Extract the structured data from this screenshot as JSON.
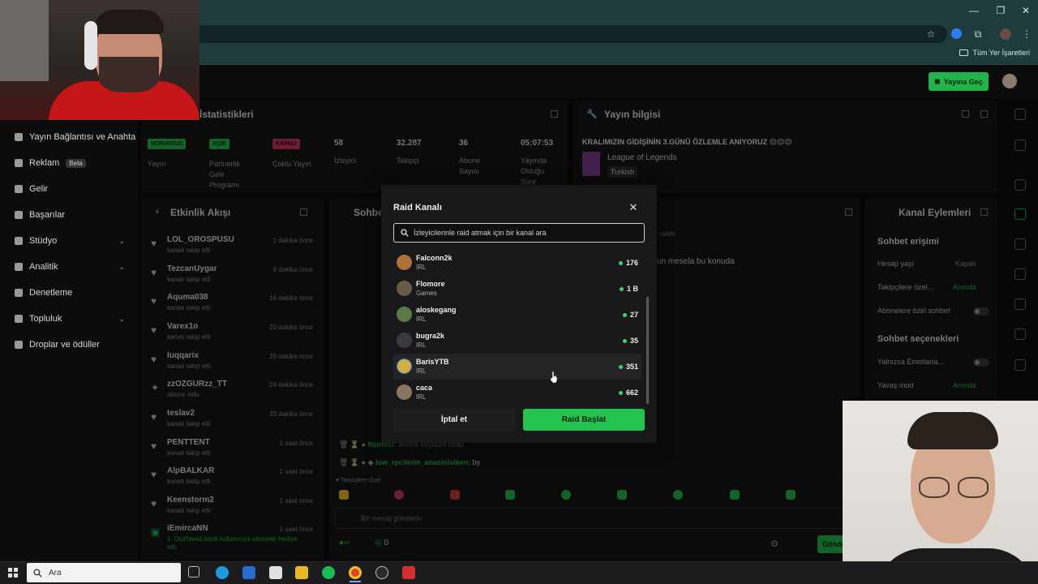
{
  "browser": {
    "bookmark_folder": "Tüm Yer İşaretleri"
  },
  "header": {
    "go_live_label": "Yayına Geç"
  },
  "sidebar": {
    "items": [
      {
        "label": "Yayın Bağlantısı ve Anahtarı"
      },
      {
        "label": "Reklam",
        "badge": "Beta"
      },
      {
        "label": "Gelir"
      },
      {
        "label": "Başarılar"
      },
      {
        "label": "Stüdyo"
      },
      {
        "label": "Analitik"
      },
      {
        "label": "Denetleme"
      },
      {
        "label": "Topluluk"
      },
      {
        "label": "Droplar ve ödüller"
      }
    ]
  },
  "stats": {
    "title": "İstatistikleri",
    "badges": [
      {
        "text": "SORUNSUZ",
        "label": "Yayın",
        "color": "#23b24a"
      },
      {
        "text": "AÇIK",
        "label": "Partnerlik Gelir Programı",
        "color": "#23b24a"
      },
      {
        "text": "KAPALI",
        "label": "Çoklu Yayın",
        "color": "#c2385a"
      }
    ],
    "numbers": [
      {
        "value": "58",
        "label": "İzleyici"
      },
      {
        "value": "32.287",
        "label": "Takipçi"
      },
      {
        "value": "36",
        "label": "Abone Sayısı"
      },
      {
        "value": "05:07:53",
        "label": "Yayında Olduğu Süre"
      }
    ]
  },
  "stream_info": {
    "title": "Yayın bilgisi",
    "stream_title": "KRALIMIZIN GİDİŞİNİN 3.GÜNÜ ÖZLEMLE ANIYORUZ 😔😔😔",
    "game": "League of Legends",
    "tag": "Turkish"
  },
  "activity": {
    "title": "Etkinlik Akışı",
    "items": [
      {
        "name": "LOL_OROSPUSU",
        "sub": "kanalı takip etti",
        "time": "1 dakika önce"
      },
      {
        "name": "TezcanUygar",
        "sub": "kanalı takip etti",
        "time": "8 dakika önce"
      },
      {
        "name": "Aquma038",
        "sub": "kanalı takip etti",
        "time": "16 dakika önce"
      },
      {
        "name": "Varex1o",
        "sub": "kanalı takip etti",
        "time": "20 dakika önce"
      },
      {
        "name": "luqqarix",
        "sub": "kanalı takip etti",
        "time": "20 dakika önce"
      },
      {
        "name": "zzOZGURzz_TT",
        "sub": "abone oldu",
        "time": "24 dakika önce"
      },
      {
        "name": "teslav2",
        "sub": "kanalı takip etti",
        "time": "33 dakika önce"
      },
      {
        "name": "PENTTENT",
        "sub": "kanalı takip etti",
        "time": "1 saat önce"
      },
      {
        "name": "AlpBALKAR",
        "sub": "kanalı takip etti",
        "time": "1 saat önce"
      },
      {
        "name": "Keenstorm2",
        "sub": "kanalı takip etti",
        "time": "1 saat önce"
      },
      {
        "name": "iEmircaNN",
        "sub": "1. OuzNead isimli kullanıcıya abonelik hediye etti.",
        "time": "1 saat önce"
      }
    ]
  },
  "chat": {
    "title": "Sohbet",
    "pinned_snippet": "un mesela bu konuda",
    "user_snippet": "caNN",
    "lines": [
      {
        "user": "flonfest",
        "text": ": amına koydum biraz"
      },
      {
        "user": "low_rpcilerin_anasinisiken",
        "text": ": by"
      }
    ],
    "followers_only": "Takipçilere Özel",
    "input_placeholder": "Bir mesaj gönderin",
    "viewer_count_small": "0",
    "send_label": "Gönder"
  },
  "channel_actions": {
    "title": "Kanal Eylemleri",
    "section1": "Sohbet erişimi",
    "rows1": [
      {
        "label": "Hesap yaşı",
        "value": "Kapalı"
      },
      {
        "label": "Takipçilere özel...",
        "value": "Anında"
      },
      {
        "label": "Abonelere özel sohbet",
        "value": ""
      }
    ],
    "section2": "Sohbet seçenekleri",
    "rows2": [
      {
        "label": "Yalnızca Emotlarla...",
        "value": ""
      },
      {
        "label": "Yavaş mod",
        "value": "Anında"
      }
    ]
  },
  "modal": {
    "title": "Raid Kanalı",
    "search_placeholder": "İzleyicilerinle raid atmak için bir kanal ara",
    "channels": [
      {
        "name": "Falconn2k",
        "category": "IRL",
        "viewers": "176",
        "avatar_color": "#b0703a"
      },
      {
        "name": "Flomore",
        "category": "Games",
        "viewers": "1 B",
        "avatar_color": "#6a5a48"
      },
      {
        "name": "aloskegang",
        "category": "IRL",
        "viewers": "27",
        "avatar_color": "#5a7a48"
      },
      {
        "name": "bugra2k",
        "category": "IRL",
        "viewers": "35",
        "avatar_color": "#3a3a44"
      },
      {
        "name": "BarisYTB",
        "category": "IRL",
        "viewers": "351",
        "avatar_color": "#d0b040"
      },
      {
        "name": "caca",
        "category": "IRL",
        "viewers": "662",
        "avatar_color": "#8a7462"
      }
    ],
    "cancel_label": "İptal et",
    "start_label": "Raid Başlat"
  },
  "taskbar": {
    "search_placeholder": "Ara"
  }
}
